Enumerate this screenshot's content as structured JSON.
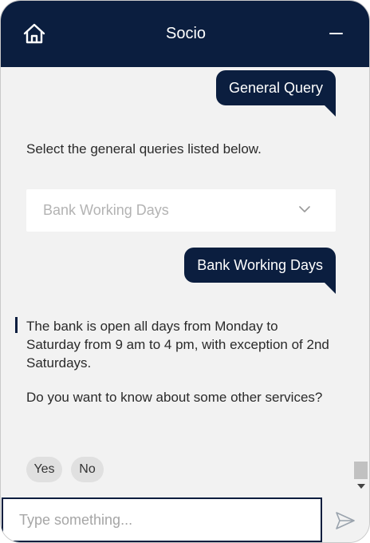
{
  "header": {
    "title": "Socio",
    "home_icon": "home-icon",
    "minimize_icon": "minimize-icon"
  },
  "messages": {
    "user_1": "General Query",
    "bot_prompt": "Select the general queries listed below.",
    "select": {
      "selected_value": "Bank Working Days",
      "icon": "chevron-down-icon"
    },
    "user_2": "Bank Working Days",
    "bot_reply_1": "The bank is open all days from Monday to Saturday from 9 am to 4 pm, with exception of 2nd Saturdays.",
    "bot_reply_2": "Do you want to know about some other services?",
    "quick_replies": [
      "Yes",
      "No"
    ]
  },
  "composer": {
    "placeholder": "Type something...",
    "send_icon": "send-icon"
  },
  "colors": {
    "primary": "#0b1e3f",
    "background": "#f2f2f2",
    "chip": "#e0e0e0"
  }
}
